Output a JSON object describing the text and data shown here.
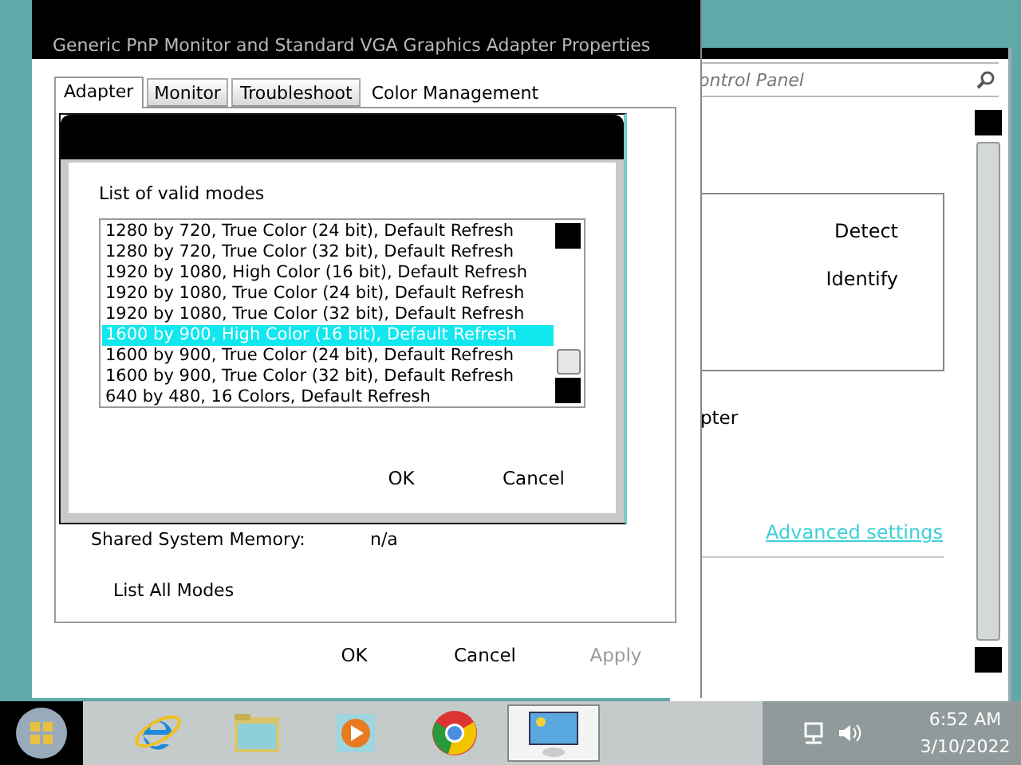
{
  "control_panel": {
    "search": {
      "placeholder": "ontrol Panel"
    },
    "buttons": [
      "Detect",
      "Identify"
    ],
    "text": "pter",
    "link": "Advanced settings"
  },
  "properties_dialog": {
    "title": "Generic PnP Monitor and Standard VGA Graphics Adapter Properties",
    "tabs": [
      {
        "label": "Adapter",
        "selected": true
      },
      {
        "label": "Monitor",
        "selected": false
      },
      {
        "label": "Troubleshoot",
        "selected": false
      },
      {
        "label": "Color Management",
        "selected": false
      }
    ],
    "shared_memory": {
      "label": "Shared System Memory:",
      "value": "n/a"
    },
    "list_all_modes_button": "List All Modes",
    "buttons": [
      {
        "label": "OK",
        "disabled": false
      },
      {
        "label": "Cancel",
        "disabled": false
      },
      {
        "label": "Apply",
        "disabled": true
      }
    ]
  },
  "modes_dialog": {
    "heading": "List of valid modes",
    "modes": [
      {
        "label": "1280 by 720, True Color (24 bit), Default Refresh",
        "selected": false
      },
      {
        "label": "1280 by 720, True Color (32 bit), Default Refresh",
        "selected": false
      },
      {
        "label": "1920 by 1080, High Color (16 bit), Default Refresh",
        "selected": false
      },
      {
        "label": "1920 by 1080, True Color (24 bit), Default Refresh",
        "selected": false
      },
      {
        "label": "1920 by 1080, True Color (32 bit), Default Refresh",
        "selected": false
      },
      {
        "label": "1600 by 900, High Color (16 bit), Default Refresh",
        "selected": true
      },
      {
        "label": "1600 by 900, True Color (24 bit), Default Refresh",
        "selected": false
      },
      {
        "label": "1600 by 900, True Color (32 bit), Default Refresh",
        "selected": false
      },
      {
        "label": "640 by 480, 16 Colors, Default Refresh",
        "selected": false
      }
    ],
    "buttons": [
      "OK",
      "Cancel"
    ]
  },
  "taskbar": {
    "apps": [
      {
        "kind": "ie",
        "selected": false
      },
      {
        "kind": "folder",
        "selected": false
      },
      {
        "kind": "media",
        "selected": false
      },
      {
        "kind": "chrome",
        "selected": false
      },
      {
        "kind": "display",
        "selected": true
      }
    ],
    "time": "6:52 AM",
    "date": "3/10/2022"
  }
}
